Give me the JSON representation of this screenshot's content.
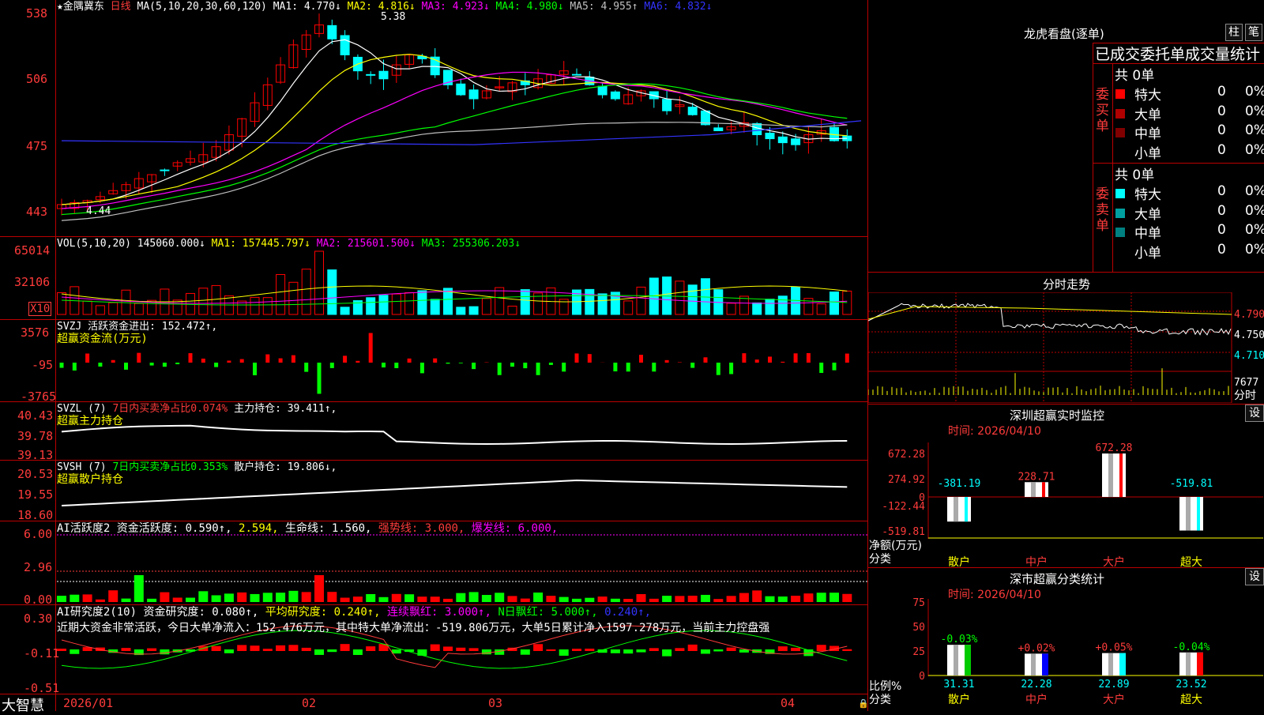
{
  "main_chart": {
    "star": "★",
    "stock_name": "金隅冀东",
    "period": "日线",
    "ma_params": "MA(5,10,20,30,60,120)",
    "ma_values": [
      {
        "label": "MA1: 4.770↓",
        "color": "#ffffff"
      },
      {
        "label": "MA2: 4.816↓",
        "color": "#ffff00"
      },
      {
        "label": "MA3: 4.923↓",
        "color": "#ff00ff"
      },
      {
        "label": "MA4: 4.980↓",
        "color": "#00ff00"
      },
      {
        "label": "MA5: 4.955↑",
        "color": "#c0c0c0"
      },
      {
        "label": "MA6: 4.832↓",
        "color": "#3333ff"
      }
    ],
    "high_mark": "5.38",
    "low_mark": "4.44",
    "y_ticks": [
      "538",
      "506",
      "475",
      "443"
    ]
  },
  "volume": {
    "title": "VOL(5,10,20)",
    "value": "145060.000↓",
    "ma1": "MA1: 157445.797↓",
    "ma2": "MA2: 215601.500↓",
    "ma3": "MA3: 255306.203↓",
    "y_ticks": [
      "65014",
      "32106"
    ],
    "unit": "X10"
  },
  "svzj": {
    "title": "SVZJ",
    "line": "活跃资金进出: 152.472↑,",
    "subtitle": "超赢资金流(万元)",
    "y_ticks": [
      "3576",
      "-95",
      "-3765"
    ]
  },
  "svzl": {
    "title": "SVZL (7)",
    "pct": "7日内买卖净占比0.074%",
    "hold": "主力持仓: 39.411↑,",
    "subtitle": "超赢主力持仓",
    "y_ticks": [
      "40.43",
      "39.78",
      "39.13"
    ]
  },
  "svsh": {
    "title": "SVSH (7)",
    "pct": "7日内买卖净占比0.353%",
    "hold": "散户持仓: 19.806↓,",
    "subtitle": "超赢散户持仓",
    "y_ticks": [
      "20.53",
      "19.55",
      "18.60"
    ]
  },
  "ai_active": {
    "title": "AI活跃度2",
    "v1": "资金活跃度: 0.590↑,",
    "v2": "2.594,",
    "v3": "生命线: 1.560,",
    "v4": "强势线: 3.000,",
    "v5": "爆发线: 6.000,",
    "y_ticks": [
      "6.00",
      "2.96",
      "0.00"
    ]
  },
  "ai_research": {
    "title": "AI研究度2(10)",
    "v1": "资金研究度: 0.080↑,",
    "v2": "平均研究度: 0.240↑,",
    "v3": "连续飘红: 3.000↑,",
    "v4": "N日飘红: 5.000↑,",
    "v5": "0.240↑,",
    "summary": "近期大资金非常活跃，今日大单净流入：152.476万元，其中特大单净流出：-519.806万元，大单5日累计净入1597.278万元，当前主力控盘强",
    "y_ticks": [
      "0.30",
      "-0.11",
      "-0.51"
    ]
  },
  "x_axis": {
    "brand": "大智慧",
    "dates": [
      "2026/01",
      "02",
      "03",
      "04"
    ]
  },
  "dragon_tiger": {
    "title": "龙虎看盘(逐单)",
    "btn_zhu": "柱",
    "btn_bi": "笔",
    "header": "已成交委托单成交量统计",
    "buy_label": "委买单",
    "sell_label": "委卖单",
    "buy_total": "共 0单",
    "sell_total": "共 0单",
    "buy_rows": [
      {
        "name": "特大",
        "count": "0",
        "pct": "0%",
        "color": "#ff0000"
      },
      {
        "name": "大单",
        "count": "0",
        "pct": "0%",
        "color": "#b00000"
      },
      {
        "name": "中单",
        "count": "0",
        "pct": "0%",
        "color": "#800000"
      },
      {
        "name": "小单",
        "count": "0",
        "pct": "0%",
        "color": ""
      }
    ],
    "sell_rows": [
      {
        "name": "特大",
        "count": "0",
        "pct": "0%",
        "color": "#00ffff"
      },
      {
        "name": "大单",
        "count": "0",
        "pct": "0%",
        "color": "#00a0a0"
      },
      {
        "name": "中单",
        "count": "0",
        "pct": "0%",
        "color": "#008080"
      },
      {
        "name": "小单",
        "count": "0",
        "pct": "0%",
        "color": ""
      }
    ]
  },
  "intraday": {
    "title": "分时走势",
    "y_ticks": [
      "4.790",
      "4.750",
      "4.710"
    ],
    "vol_tick": "7677",
    "vol_label": "分时"
  },
  "sz_monitor": {
    "title": "深圳超赢实时监控",
    "settings": "设",
    "time": "时间: 2026/04/10",
    "y_ticks": [
      "672.28",
      "274.92",
      "0",
      "-122.44",
      "-519.81"
    ],
    "y_label": "净额(万元)",
    "x_label": "分类",
    "bars": [
      {
        "name": "散户",
        "value": -381.19,
        "label": "-381.19",
        "color": "#00ffff",
        "name_color": "#ffff00"
      },
      {
        "name": "中户",
        "value": 228.71,
        "label": "228.71",
        "color": "#ff0000",
        "name_color": "#ff3b3b"
      },
      {
        "name": "大户",
        "value": 672.28,
        "label": "672.28",
        "color": "#ff0000",
        "name_color": "#ff3b3b"
      },
      {
        "name": "超大",
        "value": -519.81,
        "label": "-519.81",
        "color": "#00ffff",
        "name_color": "#ffff00"
      }
    ]
  },
  "sz_class": {
    "title": "深市超赢分类统计",
    "settings": "设",
    "time": "时间: 2026/04/10",
    "y_ticks": [
      "75",
      "50",
      "25",
      "0"
    ],
    "y_label": "比例%",
    "x_label": "分类",
    "bars": [
      {
        "name": "散户",
        "value": 31.31,
        "label": "31.31",
        "change": "-0.03%",
        "color": "#00cc00",
        "name_color": "#ffff00"
      },
      {
        "name": "中户",
        "value": 22.28,
        "label": "22.28",
        "change": "+0.02%",
        "color": "#0000ff",
        "name_color": "#ff3b3b"
      },
      {
        "name": "大户",
        "value": 22.89,
        "label": "22.89",
        "change": "+0.05%",
        "color": "#00ffff",
        "name_color": "#ff3b3b"
      },
      {
        "name": "超大",
        "value": 23.52,
        "label": "23.52",
        "change": "-0.04%",
        "color": "#ff0000",
        "name_color": "#ffff00"
      }
    ]
  },
  "colors": {
    "up": "#ff0000",
    "down": "#00ffff",
    "frame": "#b00000",
    "axis_text": "#ff3b3b"
  }
}
